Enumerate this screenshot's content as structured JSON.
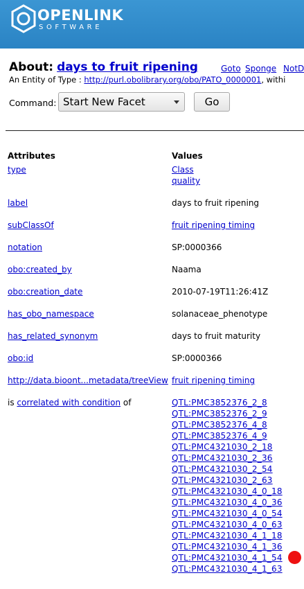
{
  "header": {
    "logo_text": "OPENLINK",
    "logo_sub": "SOFTWARE"
  },
  "about": {
    "label": "About:",
    "title": "days to fruit ripening",
    "links": [
      "Goto",
      "Sponge",
      "NotD"
    ]
  },
  "entity": {
    "prefix": "An Entity of Type : ",
    "type_link": "http://purl.obolibrary.org/obo/PATO_0000001",
    "suffix": ", withi"
  },
  "command": {
    "label": "Command:",
    "selected": "Start New Facet",
    "go_label": "Go"
  },
  "table": {
    "attr_header": "Attributes",
    "val_header": "Values",
    "rows": [
      {
        "attr": "type",
        "values": [
          "Class",
          "quality"
        ],
        "linked": true
      },
      {
        "attr": "label",
        "values": [
          "days to fruit ripening"
        ],
        "linked": false
      },
      {
        "attr": "subClassOf",
        "values": [
          "fruit ripening timing"
        ],
        "linked": true
      },
      {
        "attr": "notation",
        "values": [
          "SP:0000366"
        ],
        "linked": false
      },
      {
        "attr": "obo:created_by",
        "values": [
          "Naama"
        ],
        "linked": false
      },
      {
        "attr": "obo:creation_date",
        "values": [
          "2010-07-19T11:26:41Z"
        ],
        "linked": false
      },
      {
        "attr": "has_obo_namespace",
        "values": [
          "solanaceae_phenotype"
        ],
        "linked": false
      },
      {
        "attr": "has_related_synonym",
        "values": [
          "days to fruit maturity"
        ],
        "linked": false
      },
      {
        "attr": "obo:id",
        "values": [
          "SP:0000366"
        ],
        "linked": false
      },
      {
        "attr": "http://data.bioont...metadata/treeView",
        "values": [
          "fruit ripening timing"
        ],
        "linked": true
      }
    ],
    "inverse": {
      "prefix": "is ",
      "link": "correlated with condition",
      "suffix": " of",
      "values": [
        "QTL:PMC3852376_2_8",
        "QTL:PMC3852376_2_9",
        "QTL:PMC3852376_4_8",
        "QTL:PMC3852376_4_9",
        "QTL:PMC4321030_2_18",
        "QTL:PMC4321030_2_36",
        "QTL:PMC4321030_2_54",
        "QTL:PMC4321030_2_63",
        "QTL:PMC4321030_4_0_18",
        "QTL:PMC4321030_4_0_36",
        "QTL:PMC4321030_4_0_54",
        "QTL:PMC4321030_4_0_63",
        "QTL:PMC4321030_4_1_18",
        "QTL:PMC4321030_4_1_36",
        "QTL:PMC4321030_4_1_54",
        "QTL:PMC4321030_4_1_63"
      ]
    }
  },
  "colors": {
    "header_bg": "#2a83c4",
    "link": "#0000cc",
    "marker": "#ee1111"
  }
}
